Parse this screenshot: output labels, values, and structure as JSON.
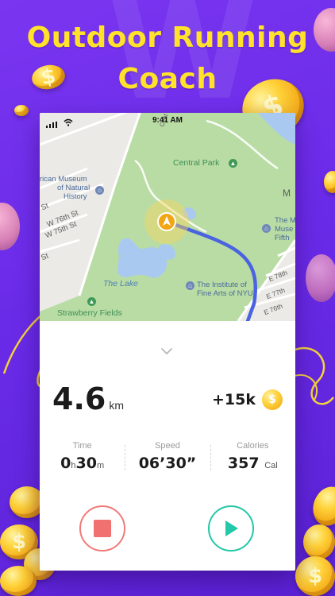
{
  "headline": {
    "line1": "Outdoor Running",
    "line2": "Coach"
  },
  "colors": {
    "background": "#6a2be8",
    "headline": "#ffe229",
    "route": "#3b5bdb",
    "park": "#b6dba0",
    "stop": "#f0716f",
    "play": "#22c8a8"
  },
  "status_bar": {
    "time": "9:41 AM"
  },
  "map": {
    "labels": {
      "central_park": "Central Park",
      "museum_line1": "rican Museum",
      "museum_line2": "of Natural",
      "museum_line3": "History",
      "w76": "W 76th St",
      "w75": "W 75th St",
      "st1": "St",
      "st2": "St",
      "the_lake": "The Lake",
      "strawberry": "Strawberry Fields",
      "institute_line1": "The Institute of",
      "institute_line2": "Fine Arts of NYU",
      "met_line1": "The M",
      "met_line2": "Muse",
      "met_line3": "Fifth",
      "e78": "E 78th",
      "e77": "E 77th",
      "e76": "E 76th",
      "m": "M",
      "cent": "Cent"
    }
  },
  "panel": {
    "distance": "4.6",
    "distance_unit": "km",
    "reward": "+15k",
    "reward_coin_symbol": "$",
    "time_label": "Time",
    "time_hours": "0",
    "time_h_unit": "h",
    "time_minutes": "30",
    "time_m_unit": "m",
    "speed_label": "Speed",
    "speed_value": "06’30”",
    "calories_label": "Calories",
    "calories_value": "357",
    "calories_unit": "Cal"
  },
  "icons": {
    "chevron": "chevron-down-icon",
    "stop": "stop-icon",
    "play": "play-icon",
    "location": "location-arrow-icon",
    "coin": "dollar-coin-icon"
  }
}
